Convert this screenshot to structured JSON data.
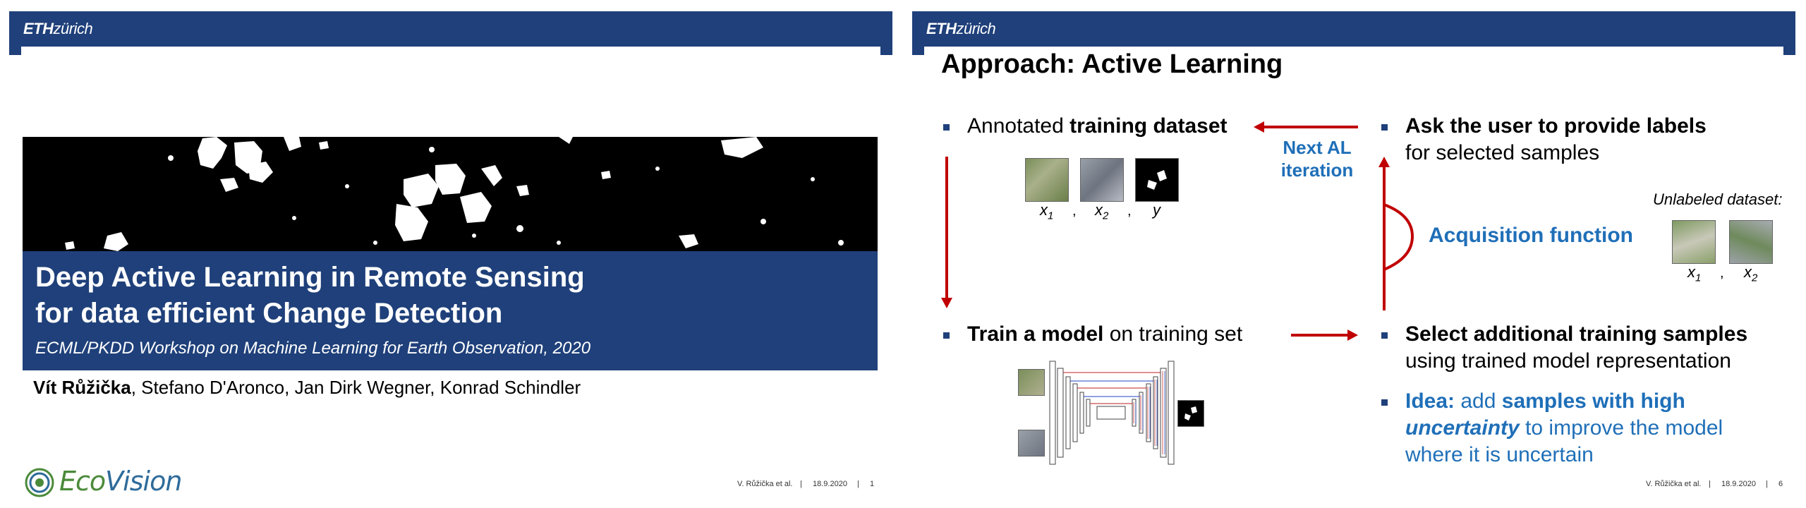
{
  "header": {
    "logo_eth": "ETH",
    "logo_zurich": "zürich"
  },
  "slide1": {
    "title_line1": "Deep Active Learning in Remote Sensing",
    "title_line2": "for data efficient Change Detection",
    "subtitle": "ECML/PKDD Workshop on Machine Learning for Earth Observation, 2020",
    "author_first": "Vít Růžička",
    "authors_rest": ", Stefano D'Aronco, Jan Dirk Wegner, Konrad Schindler",
    "logo_eco": "Eco",
    "logo_vision": "Vision",
    "footer_author": "V. Růžička et al.",
    "footer_sep": "|",
    "footer_date": "18.9.2020",
    "footer_page": "1"
  },
  "slide2": {
    "title": "Approach: Active Learning",
    "b1_normal": "Annotated ",
    "b1_bold": "training dataset",
    "var_x1": "x",
    "sub_1": "1",
    "var_x2": "x",
    "sub_2": "2",
    "var_y": "y",
    "comma": ",",
    "next_al_line1": "Next AL",
    "next_al_line2": "iteration",
    "b2_bold": "Ask the user to provide labels",
    "b2_normal": "for selected samples",
    "unlabeled_label": "Unlabeled dataset:",
    "acquisition": "Acquisition function",
    "b3_bold": "Train a model",
    "b3_normal": " on training set",
    "b4_bold": "Select additional training samples",
    "b4_normal": "using trained model representation",
    "b5_idea": "Idea:",
    "b5_mid": " add ",
    "b5_bold": "samples with high",
    "b5_uncertainty": "uncertainty",
    "b5_rest1": " to improve the model",
    "b5_rest2": "where it is uncertain",
    "footer_author": "V. Růžička et al.",
    "footer_sep": "|",
    "footer_date": "18.9.2020",
    "footer_page": "6"
  },
  "colors": {
    "eth_blue": "#1f407a",
    "accent_blue": "#1f6fb8",
    "arrow_red": "#c00000"
  }
}
